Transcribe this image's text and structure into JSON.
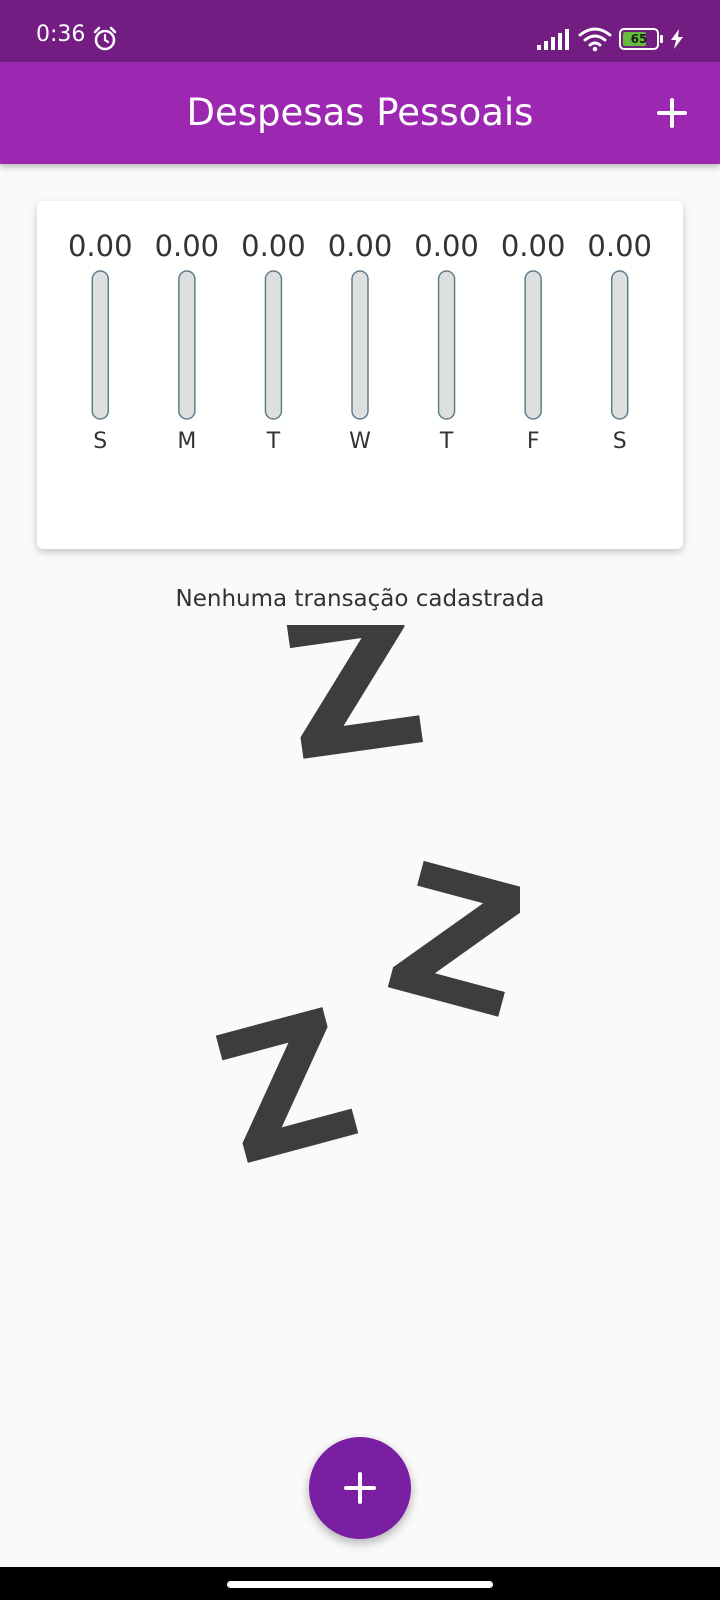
{
  "status_bar": {
    "time": "0:36",
    "battery_level": "65",
    "icons": [
      "alarm-icon",
      "signal-icon",
      "wifi-icon",
      "battery-icon",
      "charging-bolt-icon"
    ]
  },
  "app_bar": {
    "title": "Despesas Pessoais",
    "action_icon": "plus-icon"
  },
  "chart_data": {
    "type": "bar",
    "categories": [
      "S",
      "M",
      "T",
      "W",
      "T",
      "F",
      "S"
    ],
    "value_labels": [
      "0.00",
      "0.00",
      "0.00",
      "0.00",
      "0.00",
      "0.00",
      "0.00"
    ],
    "values": [
      0,
      0,
      0,
      0,
      0,
      0,
      0
    ],
    "colors": {
      "track": "#dfdfdf",
      "track_border": "#607d8b",
      "fill": "#9c27b0"
    }
  },
  "empty_state": {
    "message": "Nenhuma transação cadastrada",
    "illustration": "sleeping-zzz-icon"
  },
  "fab": {
    "icon": "plus-icon"
  },
  "colors": {
    "status_bar": "#731d83",
    "app_bar": "#9c27b0",
    "fab": "#7b1fa2",
    "background": "#fafafa"
  }
}
